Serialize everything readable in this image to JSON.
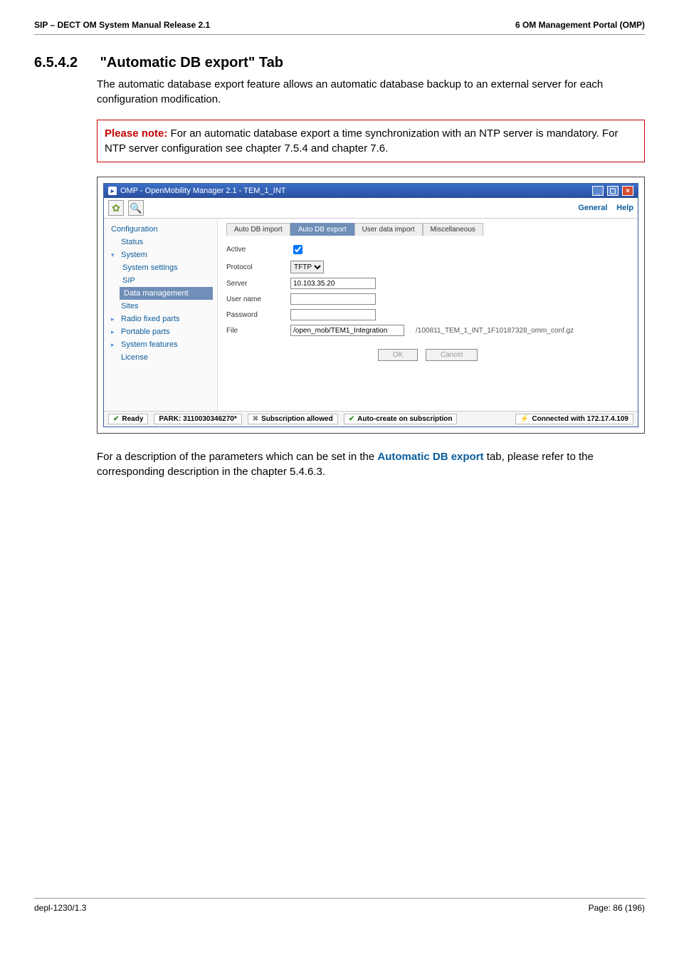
{
  "header": {
    "left": "SIP – DECT OM System Manual Release 2.1",
    "right": "6 OM Management Portal (OMP)"
  },
  "section": {
    "number": "6.5.4.2",
    "title": "\"Automatic DB export\" Tab"
  },
  "intro": "The automatic database export feature allows an automatic database backup to an external server for each configuration modification.",
  "note": {
    "label": "Please note:",
    "text": " For an automatic database export a time synchronization with an NTP server is mandatory. For NTP server configuration see chapter 7.5.4 and chapter 7.6."
  },
  "win": {
    "title": "OMP - OpenMobility Manager 2.1 - TEM_1_INT",
    "menu": {
      "general": "General",
      "help": "Help"
    },
    "sidebar": {
      "configuration": "Configuration",
      "status": "Status",
      "system": "System",
      "system_settings": "System settings",
      "sip": "SIP",
      "data_management": "Data management",
      "sites": "Sites",
      "radio_fixed_parts": "Radio fixed parts",
      "portable_parts": "Portable parts",
      "system_features": "System features",
      "license": "License"
    },
    "tabs": {
      "auto_db_import": "Auto DB import",
      "auto_db_export": "Auto DB export",
      "user_data_import": "User data import",
      "miscellaneous": "Miscellaneous"
    },
    "form": {
      "active_label": "Active",
      "protocol_label": "Protocol",
      "protocol_value": "TFTP",
      "server_label": "Server",
      "server_value": "10.103.35.20",
      "username_label": "User name",
      "password_label": "Password",
      "file_label": "File",
      "file_value": "/open_mob/TEM1_Integration",
      "file_suffix": "/100811_TEM_1_INT_1F10187328_omm_conf.gz"
    },
    "buttons": {
      "ok": "OK",
      "cancel": "Cancel"
    },
    "status": {
      "ready": "Ready",
      "park": "PARK: 3110030346270*",
      "subscription": "Subscription allowed",
      "autocreate": "Auto-create on subscription",
      "connected": "Connected with 172.17.4.109"
    }
  },
  "closing": {
    "pre": "For a description of the parameters which can be set in the ",
    "bold": "Automatic DB export",
    "post": " tab, please refer to the corresponding description in the chapter 5.4.6.3."
  },
  "footer": {
    "left": "depl-1230/1.3",
    "right": "Page: 86 (196)"
  }
}
